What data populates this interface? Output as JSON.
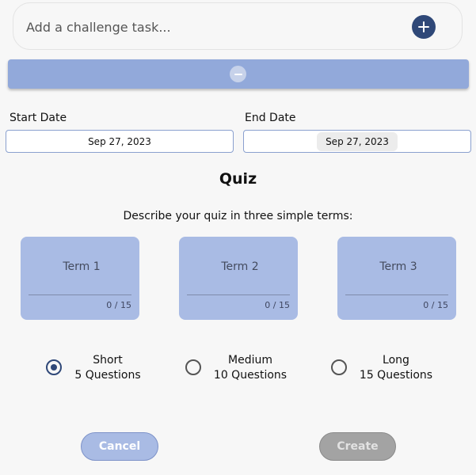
{
  "task_input": {
    "placeholder": "Add a challenge task..."
  },
  "icons": {
    "add": "plus-circle-icon",
    "remove": "minus-circle-icon"
  },
  "dates": {
    "start_label": "Start Date",
    "start_value": "Sep 27, 2023",
    "end_label": "End Date",
    "end_value": "Sep 27, 2023"
  },
  "quiz": {
    "title": "Quiz",
    "description": "Describe your quiz in three simple terms:",
    "terms": [
      {
        "placeholder": "Term 1",
        "count": "0 / 15"
      },
      {
        "placeholder": "Term 2",
        "count": "0 / 15"
      },
      {
        "placeholder": "Term 3",
        "count": "0 / 15"
      }
    ],
    "lengths": [
      {
        "name": "Short",
        "detail": "5 Questions",
        "selected": true
      },
      {
        "name": "Medium",
        "detail": "10 Questions",
        "selected": false
      },
      {
        "name": "Long",
        "detail": "15 Questions",
        "selected": false
      }
    ]
  },
  "actions": {
    "cancel": "Cancel",
    "create": "Create"
  },
  "colors": {
    "accent": "#2f4878",
    "bar": "#92a9da",
    "card": "#a9bbe4",
    "disabled": "#a3a3a3"
  }
}
